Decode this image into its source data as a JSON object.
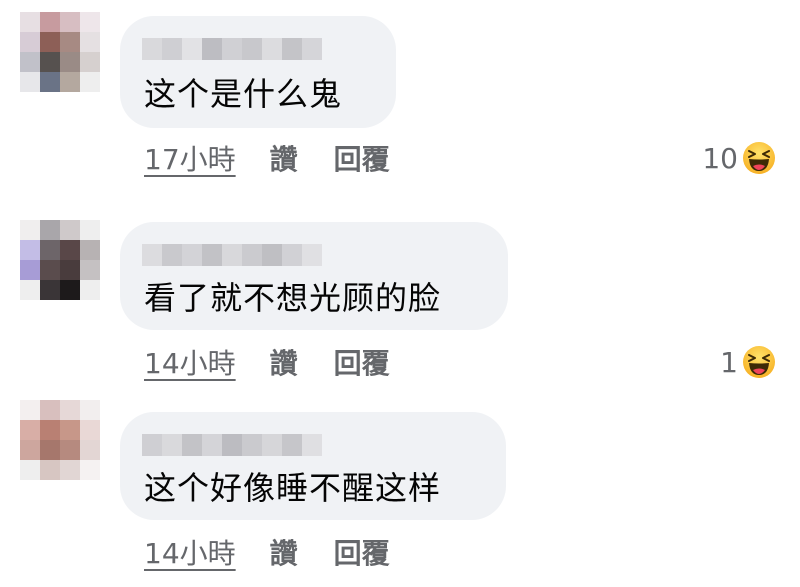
{
  "comments": [
    {
      "text": "这个是什么鬼",
      "time": "17小時",
      "like_label": "讚",
      "reply_label": "回覆",
      "reaction_count": "10",
      "reaction_icon": "haha-emoji-icon",
      "avatar_colors": [
        "#e7dfe3",
        "#c79b9f",
        "#d7bec2",
        "#eee6ea",
        "#d7ccd6",
        "#8d5f57",
        "#a78a83",
        "#e5e0e2",
        "#c1c1c9",
        "#56514f",
        "#9a8b86",
        "#d6d0cf",
        "#e7e7ea",
        "#6a7386",
        "#b4a89f",
        "#eeeeee"
      ],
      "name_blur_colors": [
        "#d9d9dc",
        "#cfcfd3",
        "#e2e2e5",
        "#bdbdc2",
        "#d0d0d4",
        "#c8c8cc",
        "#dcdcdf",
        "#c4c4c8",
        "#d5d5d9"
      ]
    },
    {
      "text": "看了就不想光顾的脸",
      "time": "14小時",
      "like_label": "讚",
      "reply_label": "回覆",
      "reaction_count": "1",
      "reaction_icon": "haha-emoji-icon",
      "avatar_colors": [
        "#f0eeee",
        "#a9a6aa",
        "#cfc9ca",
        "#eeeeee",
        "#c3bde6",
        "#6d6569",
        "#594748",
        "#b7b2b3",
        "#a79cd6",
        "#5a4c4d",
        "#493c3d",
        "#c5c1c2",
        "#eeeeee",
        "#3a3537",
        "#1d1a1b",
        "#eeeeee"
      ],
      "name_blur_colors": [
        "#dcdcdf",
        "#c9c9cd",
        "#d3d3d7",
        "#c2c2c6",
        "#d8d8db",
        "#cbcbcf",
        "#bfbfc3",
        "#d1d1d5",
        "#e0e0e3"
      ]
    },
    {
      "text": "这个好像睡不醒这样",
      "time": "14小時",
      "like_label": "讚",
      "reply_label": "回覆",
      "reaction_count": "",
      "reaction_icon": "",
      "avatar_colors": [
        "#f3efef",
        "#d8bfbe",
        "#e6d8d7",
        "#f2eeee",
        "#d8aea6",
        "#b98073",
        "#c79789",
        "#e9d8d6",
        "#cda69e",
        "#a6776c",
        "#b68a7f",
        "#e3d6d4",
        "#eeeeee",
        "#d7c6c2",
        "#e1d6d4",
        "#f5f2f2"
      ],
      "name_blur_colors": [
        "#cfcfd3",
        "#d9d9dc",
        "#c3c3c7",
        "#d4d4d8",
        "#bcbcc1",
        "#cacace",
        "#d6d6d9",
        "#c6c6ca",
        "#dfdfe2"
      ]
    }
  ]
}
